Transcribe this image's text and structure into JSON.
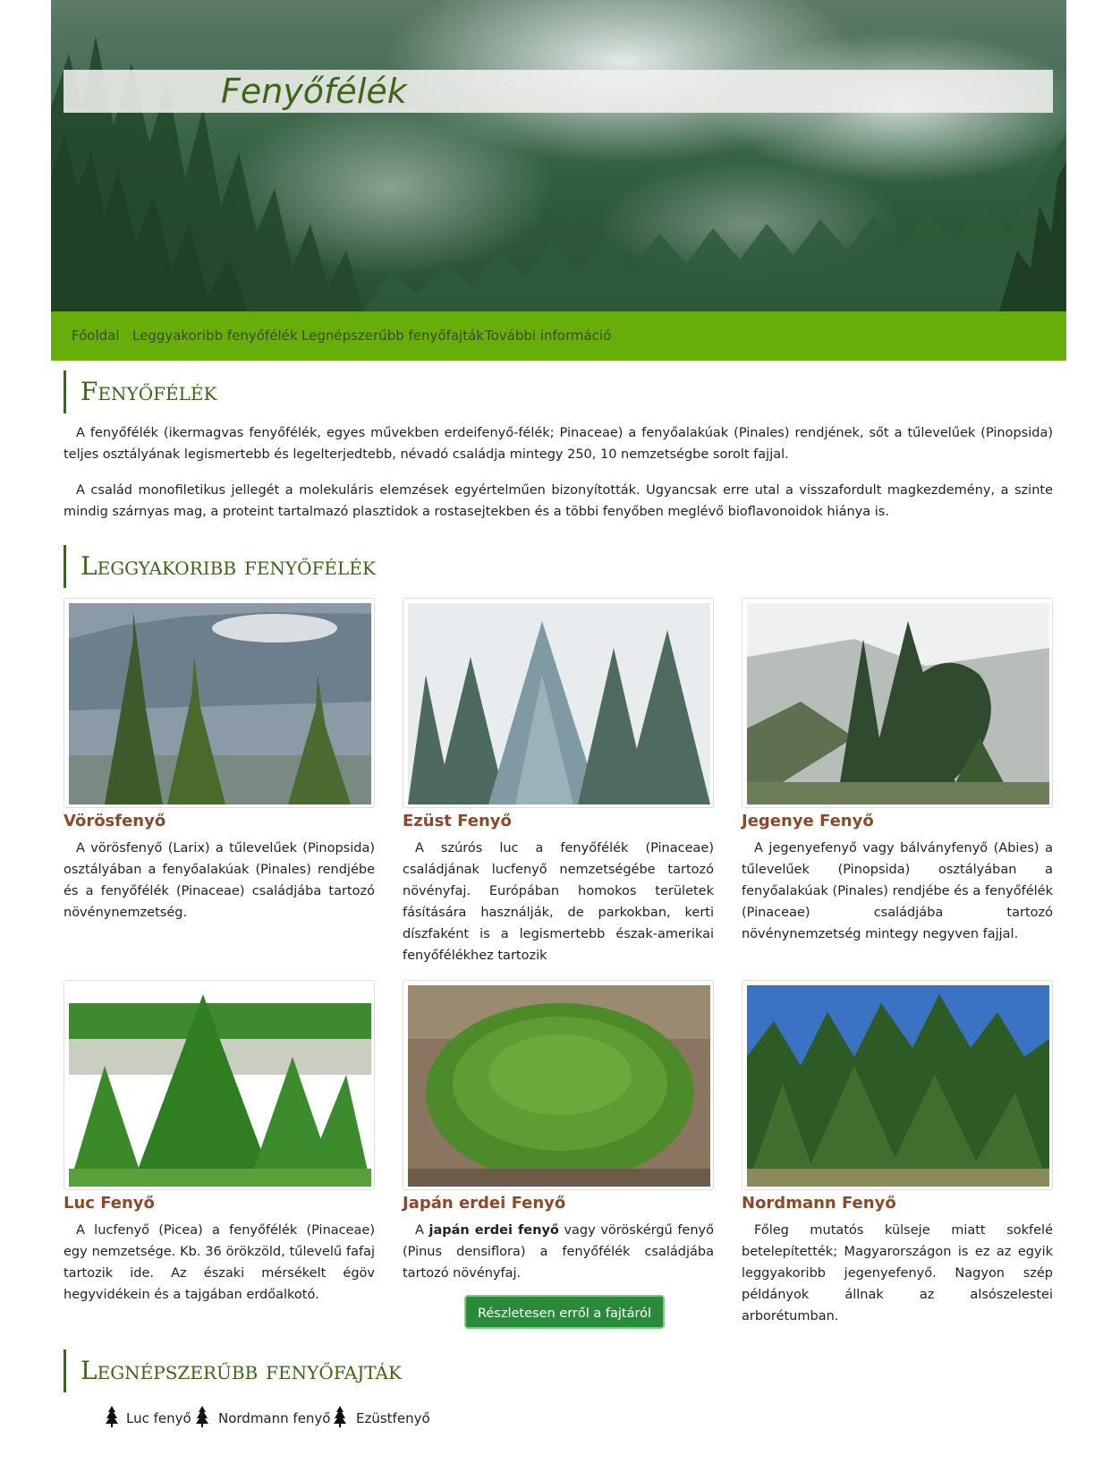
{
  "header": {
    "title": "Fenyőfélék"
  },
  "nav": {
    "items": [
      {
        "label": "Főoldal"
      },
      {
        "label": "Leggyakoribb fenyőfélék"
      },
      {
        "label": "Legnépszerűbb fenyőfajták"
      },
      {
        "label": "További információ"
      }
    ]
  },
  "intro": {
    "heading": "Fenyőfélék",
    "paragraphs": [
      "A fenyőfélék (ikermagvas fenyőfélék, egyes művekben erdeifenyő-félék; Pinaceae) a fenyőalakúak (Pinales) rendjének, sőt a tűlevelűek (Pinopsida) teljes osztályának legismertebb és legelterjedtebb, névadó családja mintegy 250, 10 nemzetségbe sorolt fajjal.",
      "A család monofiletikus jellegét a molekuláris elemzések egyértelműen bizonyították. Ugyancsak erre utal a visszafordult magkezdemény, a szinte mindig szárnyas mag, a proteint tartalmazó plasztidok a rostasejtekben és a többi fenyőben meglévő bioflavonoidok hiánya is."
    ]
  },
  "common": {
    "heading": "Leggyakoribb fenyőfélék",
    "cards": [
      {
        "name": "Vörösfenyő",
        "desc": "A vörösfenyő (Larix) a tűlevelűek (Pinopsida) osztályában a fenyőalakúak (Pinales) rendjébe és a fenyőfélék (Pinaceae) családjába tartozó növénynemzetség."
      },
      {
        "name": "Ezüst Fenyő",
        "desc": "A szúrós luc a fenyőfélék (Pinaceae) családjának lucfenyő nemzetségébe tartozó növényfaj. Európában homokos területek fásítására használják, de parkokban, kerti díszfaként is a legismertebb észak-amerikai fenyőfélékhez tartozik"
      },
      {
        "name": "Jegenye Fenyő",
        "desc": "A jegenyefenyő vagy bálványfenyő (Abies) a tűlevelűek (Pinopsida) osztályában a fenyőalakúak (Pinales) rendjébe és a fenyőfélék (Pinaceae) családjába tartozó növénynemzetség mintegy negyven fajjal."
      },
      {
        "name": "Luc Fenyő",
        "desc": "A lucfenyő (Picea) a fenyőfélék (Pinaceae) egy nemzetsége. Kb. 36 örökzöld, tűlevelű fafaj tartozik ide. Az északi mérsékelt égöv hegyvidékein és a tajgában erdőalkotó."
      },
      {
        "name": "Japán erdei Fenyő",
        "desc_pre": "A ",
        "desc_bold": "japán erdei fenyő",
        "desc_post": " vagy vöröskérgű fenyő (Pinus densiflora) a fenyőfélék családjába tartozó növényfaj."
      },
      {
        "name": "Nordmann Fenyő",
        "desc": "Főleg mutatós külseje miatt sokfelé betelepítették; Magyarországon is ez az egyik leggyakoribb jegenyefenyő. Nagyon szép példányok állnak az alsószelestei arborétumban."
      }
    ],
    "button_label": "Részletesen erről a fajtáról"
  },
  "popular": {
    "heading": "Legnépszerűbb fenyőfajták",
    "items": [
      {
        "label": "Luc fenyő",
        "icon": "tree-icon"
      },
      {
        "label": "Nordmann fenyő",
        "icon": "tree-icon"
      },
      {
        "label": "Ezüstfenyő",
        "icon": "tree-icon"
      }
    ]
  },
  "colors": {
    "nav_bg": "#68ae0a",
    "heading": "#3d6617",
    "card_title": "#8a4a2a",
    "button_bg": "#2a8a3a"
  }
}
